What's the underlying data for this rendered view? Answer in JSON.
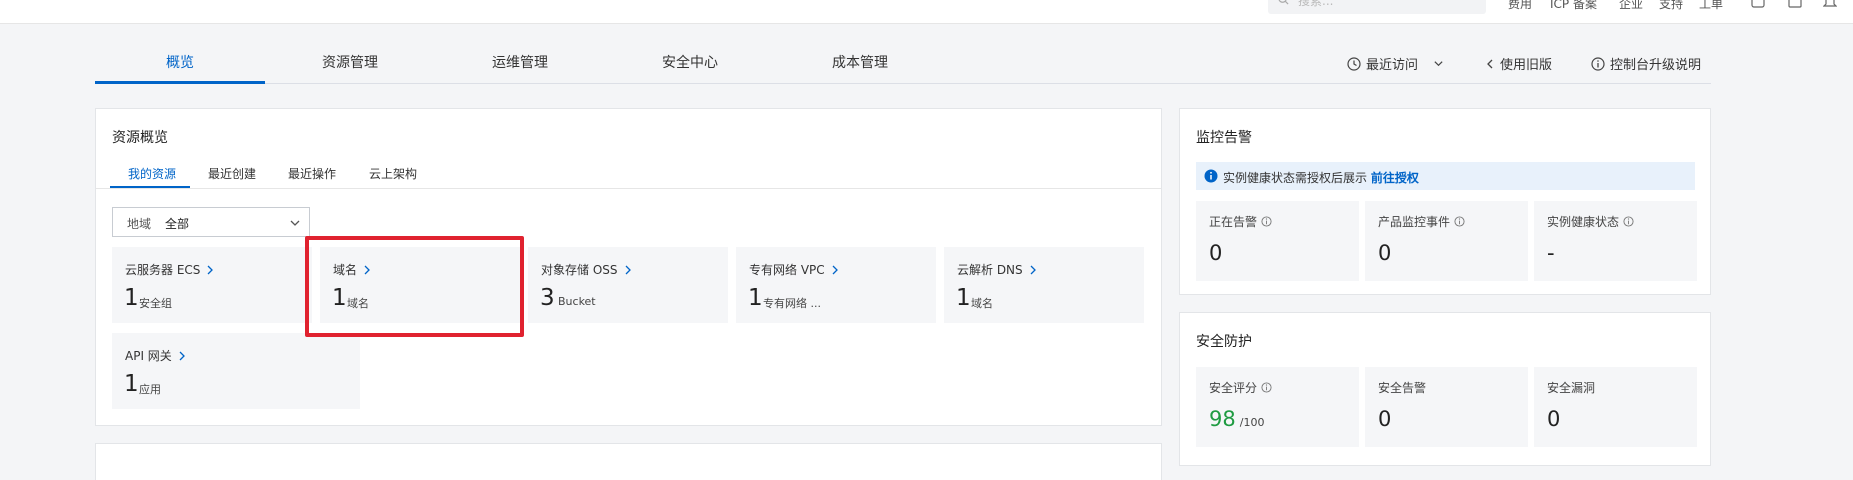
{
  "topbar": {
    "search_placeholder": "搜索...",
    "links": [
      "费用",
      "ICP 备案",
      "企业",
      "支持",
      "工单"
    ]
  },
  "nav": {
    "tabs": [
      "概览",
      "资源管理",
      "运维管理",
      "安全中心",
      "成本管理"
    ],
    "active_tab": "概览",
    "recent": "最近访问",
    "old_version": "使用旧版",
    "upgrade_note": "控制台升级说明"
  },
  "resources": {
    "title": "资源概览",
    "sub_tabs": [
      "我的资源",
      "最近创建",
      "最近操作",
      "云上架构"
    ],
    "active_sub_tab": "我的资源",
    "region": {
      "label": "地域",
      "value": "全部"
    },
    "tiles": [
      {
        "name": "云服务器 ECS",
        "count": "1",
        "unit": "安全组"
      },
      {
        "name": "域名",
        "count": "1",
        "unit": "域名"
      },
      {
        "name": "对象存储 OSS",
        "count": "3",
        "unit": "Bucket"
      },
      {
        "name": "专有网络 VPC",
        "count": "1",
        "unit": "专有网络 ..."
      },
      {
        "name": "云解析 DNS",
        "count": "1",
        "unit": "域名"
      },
      {
        "name": "API 网关",
        "count": "1",
        "unit": "应用"
      }
    ]
  },
  "monitoring": {
    "title": "监控告警",
    "notice": "实例健康状态需授权后展示",
    "notice_link": "前往授权",
    "stats": [
      {
        "label": "正在告警",
        "value": "0"
      },
      {
        "label": "产品监控事件",
        "value": "0"
      },
      {
        "label": "实例健康状态",
        "value": "-"
      }
    ]
  },
  "security": {
    "title": "安全防护",
    "stats": [
      {
        "label": "安全评分",
        "value": "98",
        "suffix": "/100"
      },
      {
        "label": "安全告警",
        "value": "0"
      },
      {
        "label": "安全漏洞",
        "value": "0"
      }
    ]
  },
  "colors": {
    "accent": "#0064c8",
    "highlight": "#e0222f",
    "score_green": "#1f9b42"
  }
}
